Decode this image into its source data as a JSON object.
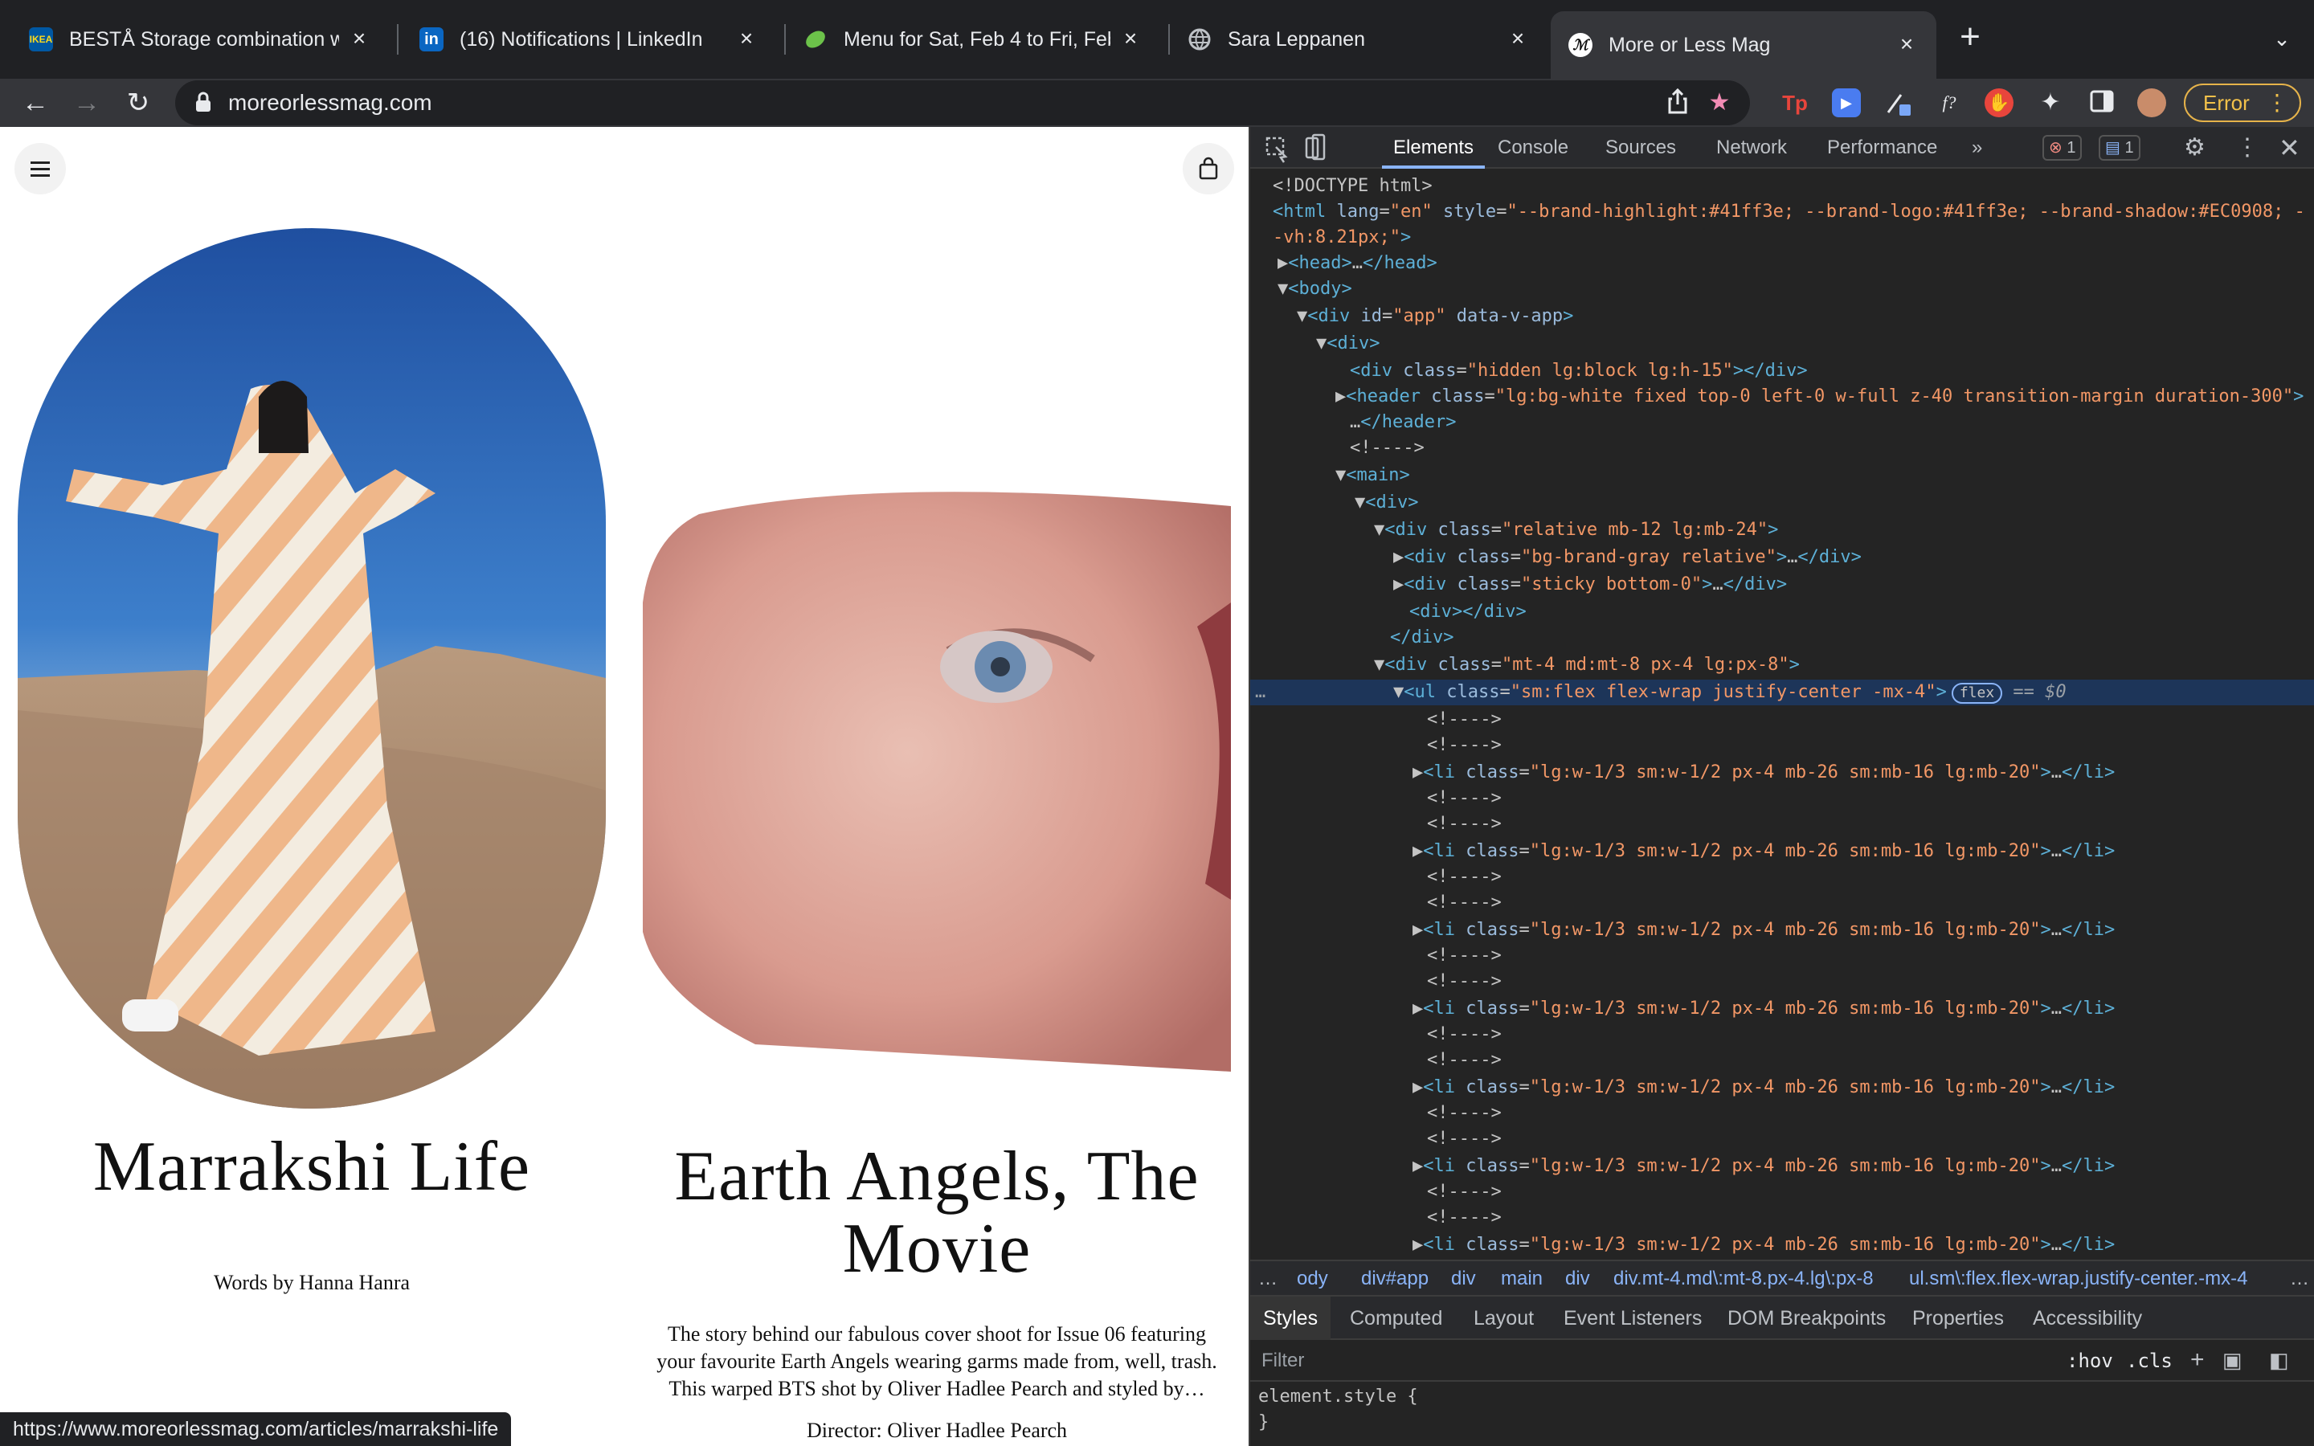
{
  "tabs": [
    {
      "title": "BESTÅ Storage combination wi",
      "favicon": "ikea-icon",
      "fav_color": "#0058a3"
    },
    {
      "title": "(16) Notifications | LinkedIn",
      "favicon": "linkedin-icon",
      "fav_color": "#0a66c2"
    },
    {
      "title": "Menu for Sat, Feb 4 to Fri, Feb",
      "favicon": "leaf-icon",
      "fav_color": "#5cb85c"
    },
    {
      "title": "Sara Leppanen",
      "favicon": "globe-icon",
      "fav_color": "#5f6368"
    },
    {
      "title": "More or Less Mag",
      "favicon": "mol-logo-icon",
      "fav_color": "#ffffff",
      "active": true
    }
  ],
  "toolbar": {
    "url": "moreorlessmag.com",
    "error_label": "Error"
  },
  "page": {
    "articles": [
      {
        "title": "Marrakshi Life",
        "byline": "Words by Hanna Hanra"
      },
      {
        "title_line1": "Earth Angels, The",
        "title_line2": "Movie",
        "desc_lines": [
          "The story behind our fabulous cover shoot for Issue 06 featuring",
          "your favourite Earth Angels wearing garms made from, well, trash.",
          "This warped BTS shot by Oliver Hadlee Pearch and styled by…"
        ],
        "director": "Director: Oliver Hadlee Pearch"
      }
    ],
    "status_url": "https://www.moreorlessmag.com/articles/marrakshi-life"
  },
  "devtools": {
    "tabs": [
      "Elements",
      "Console",
      "Sources",
      "Network",
      "Performance"
    ],
    "more": "»",
    "error_count": "1",
    "message_count": "1",
    "breadcrumbs": [
      "ody",
      "div#app",
      "div",
      "main",
      "div",
      "div.mt-4.md\\:mt-8.px-4.lg\\:px-8",
      "ul.sm\\:flex.flex-wrap.justify-center.-mx-4"
    ],
    "style_tabs": [
      "Styles",
      "Computed",
      "Layout",
      "Event Listeners",
      "DOM Breakpoints",
      "Properties",
      "Accessibility"
    ],
    "filter_placeholder": "Filter",
    "hov": ":hov",
    "cls": ".cls",
    "element_style_1": "element.style {",
    "element_style_2": "}",
    "flex_pill": "flex",
    "sel_suffix": " == $0",
    "li_class": "lg:w-1/3 sm:w-1/2 px-4 mb-26 sm:mb-16 lg:mb-20",
    "comment": "<!---->",
    "dom": {
      "doctype": "<!DOCTYPE html>",
      "html_style_1": "--brand-highlight:#41ff3e; --brand-logo:#41ff3e; --brand-shadow:#EC0908; -",
      "html_style_2": "-vh:8.21px;",
      "header_class": "lg:bg-white fixed top-0 left-0 w-full z-40 transition-margin duration-300",
      "hidden_class": "hidden lg:block lg:h-15",
      "rel_class": "relative mb-12 lg:mb-24",
      "gray_class": "bg-brand-gray relative",
      "sticky_class": "sticky bottom-0",
      "mt_class": "mt-4 md:mt-8 px-4 lg:px-8",
      "ul_class": "sm:flex flex-wrap justify-center -mx-4"
    }
  }
}
